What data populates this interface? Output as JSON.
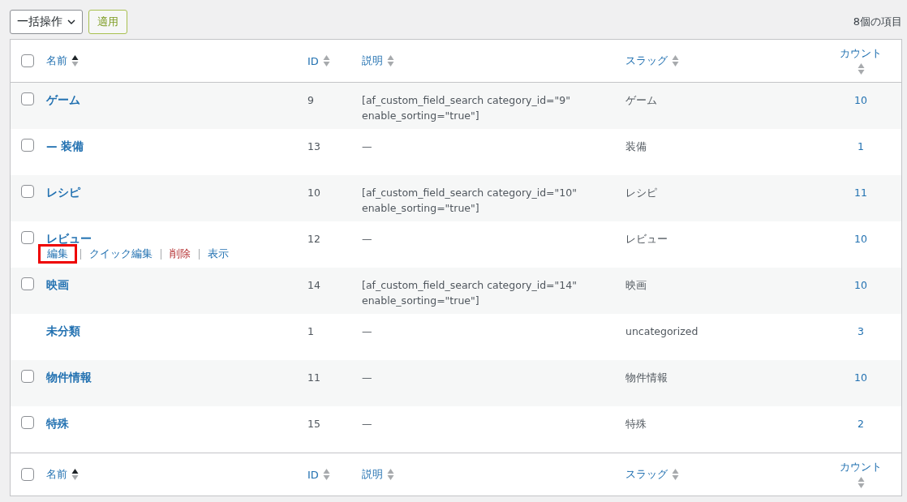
{
  "bulk_actions": {
    "dropdown": "一括操作",
    "apply_button": "適用"
  },
  "item_count": "8個の項目",
  "columns": [
    {
      "label": "名前",
      "sorted": true
    },
    {
      "label": "ID",
      "sorted": false
    },
    {
      "label": "説明",
      "sorted": false
    },
    {
      "label": "スラッグ",
      "sorted": false
    },
    {
      "label": "カウント",
      "sorted": false
    }
  ],
  "footer_columns": [
    {
      "label": "名前",
      "sorted": true
    },
    {
      "label": "ID",
      "sorted": false
    },
    {
      "label": "説明",
      "sorted": false
    },
    {
      "label": "スラッグ",
      "sorted": false
    },
    {
      "label": "カウント",
      "sorted": false
    }
  ],
  "header_checkbox": {
    "checked": false
  },
  "footer_checkbox": {
    "checked": false
  },
  "rows": [
    {
      "checked": false,
      "name": "ゲーム",
      "id": "9",
      "description": "[af_custom_field_search category_id=\"9\" enable_sorting=\"true\"]",
      "slug": "ゲーム",
      "count": "10"
    },
    {
      "checked": false,
      "name": "— 装備",
      "id": "13",
      "description": "—",
      "slug": "装備",
      "count": "1"
    },
    {
      "checked": false,
      "name": "レシピ",
      "id": "10",
      "description": "[af_custom_field_search category_id=\"10\" enable_sorting=\"true\"]",
      "slug": "レシピ",
      "count": "11"
    },
    {
      "checked": false,
      "name": "レビュー",
      "id": "12",
      "description": "—",
      "slug": "レビュー",
      "count": "10",
      "actions": [
        {
          "label": "編集",
          "kind": "normal",
          "highlighted": true
        },
        {
          "label": "クイック編集",
          "kind": "normal",
          "highlighted": false
        },
        {
          "label": "削除",
          "kind": "delete",
          "highlighted": false
        },
        {
          "label": "表示",
          "kind": "normal",
          "highlighted": false
        }
      ]
    },
    {
      "checked": false,
      "name": "映画",
      "id": "14",
      "description": "[af_custom_field_search category_id=\"14\" enable_sorting=\"true\"]",
      "slug": "映画",
      "count": "10"
    },
    {
      "name": "未分類",
      "id": "1",
      "description": "—",
      "slug": "uncategorized",
      "count": "3"
    },
    {
      "checked": false,
      "name": "物件情報",
      "id": "11",
      "description": "—",
      "slug": "物件情報",
      "count": "10"
    },
    {
      "checked": false,
      "name": "特殊",
      "id": "15",
      "description": "—",
      "slug": "特殊",
      "count": "2"
    }
  ]
}
